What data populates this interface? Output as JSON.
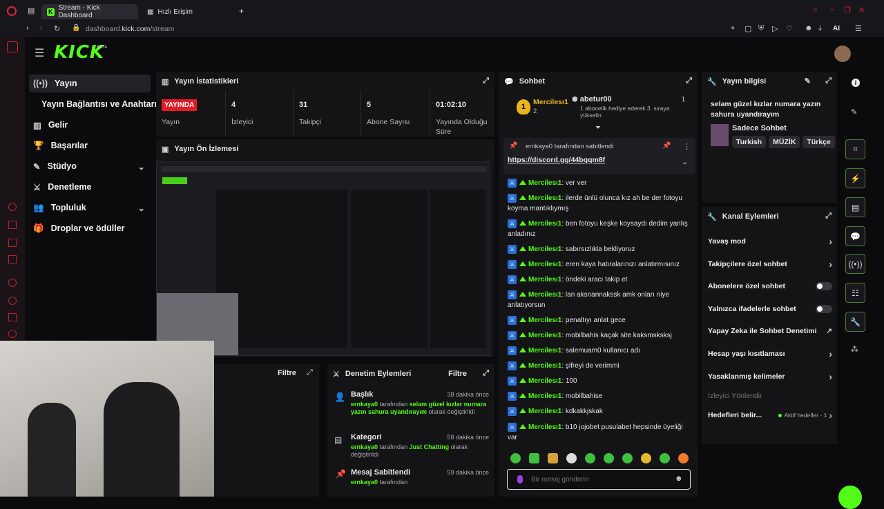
{
  "browser": {
    "tabs": [
      {
        "label": "Stream - Kick Dashboard"
      },
      {
        "label": "Hızlı Erişim"
      }
    ],
    "url_prefix": "dashboard.",
    "url_host": "kick.com",
    "url_path": "/stream",
    "ai_label": "AI"
  },
  "brand": {
    "logo": "KICK",
    "beta": "BETA"
  },
  "nav": {
    "items": [
      {
        "label": "Yayın"
      },
      {
        "label": "Yayın Bağlantısı ve Anahtarı"
      },
      {
        "label": "Gelir"
      },
      {
        "label": "Başarılar"
      },
      {
        "label": "Stüdyo"
      },
      {
        "label": "Denetleme"
      },
      {
        "label": "Topluluk"
      },
      {
        "label": "Droplar ve ödüller"
      }
    ]
  },
  "stats": {
    "title": "Yayın İstatistikleri",
    "live_badge": "YAYINDA",
    "items": [
      {
        "label": "Yayın",
        "value": ""
      },
      {
        "label": "İzleyici",
        "value": "4"
      },
      {
        "label": "Takipçi",
        "value": "31"
      },
      {
        "label": "Abone Sayısı",
        "value": "5"
      },
      {
        "label": "Yayında Olduğu Süre",
        "value": "01:02:10"
      }
    ]
  },
  "preview": {
    "title": "Yayın Ön İzlemesi"
  },
  "filter_panel": {
    "filter_label": "Filtre"
  },
  "mod_actions": {
    "title": "Denetim Eylemleri",
    "filter_label": "Filtre",
    "items": [
      {
        "title": "Başlık",
        "time": "38 dakika önce",
        "actor": "ernkaya0",
        "pre": " tarafından ",
        "highlight": "selam güzel kızlar numara yazın sahura uyandırayım",
        "post": " olarak değiştirildi"
      },
      {
        "title": "Kategori",
        "time": "58 dakika önce",
        "actor": "ernkaya0",
        "pre": " tarafından ",
        "highlight": "Just Chatting",
        "post": " olarak değiştirildi"
      },
      {
        "title": "Mesaj Sabitlendi",
        "time": "59 dakika önce",
        "actor": "ernkaya0",
        "pre": " tarafından",
        "highlight": "",
        "post": ""
      }
    ]
  },
  "chat": {
    "title": "Sohbet",
    "top_gifter": {
      "name": "Mercilesı1",
      "count": "2"
    },
    "gift_user": {
      "name": "abetur00",
      "count": "1",
      "text": "1 abonelik hediye ederek 3. sıraya yükselin"
    },
    "pinned": {
      "by": "ernkaya0 tarafından sabitlendi",
      "link": "https://discord.gg/44bqqm8f"
    },
    "messages": [
      {
        "user": "Mercilesı1",
        "text": ": ver ver"
      },
      {
        "user": "Mercilesı1",
        "text": ": ilerde ünlü olunca kız ah be der fotoyu koyma mantıklıymış"
      },
      {
        "user": "Mercilesı1",
        "text": ": ben fotoyu keşke koysaydı dedim yanlış anladınız"
      },
      {
        "user": "Mercilesı1",
        "text": ": sabırsızlıkla bekliyoruz"
      },
      {
        "user": "Mercilesı1",
        "text": ": eren kaya hatıralarınızı anlatırmısınız"
      },
      {
        "user": "Mercilesı1",
        "text": ": öndeki aracı takip et"
      },
      {
        "user": "Mercilesı1",
        "text": ": lan aksnannakssk amk onları niye anlatıyorsun"
      },
      {
        "user": "Mercilesı1",
        "text": ": penaltıyı anlat gece"
      },
      {
        "user": "Mercilesı1",
        "text": ": mobilbahis kaçak site kaksmsksksj"
      },
      {
        "user": "Mercilesı1",
        "text": ": salemuam0 kullanıcı adı"
      },
      {
        "user": "Mercilesı1",
        "text": ": şifreyi de verimmi"
      },
      {
        "user": "Mercilesı1",
        "text": ": 100"
      },
      {
        "user": "Mercilesı1",
        "text": ": mobilbahise"
      },
      {
        "user": "Mercilesı1",
        "text": ": kdkakkjskak"
      },
      {
        "user": "Mercilesı1",
        "text": ": b10 jojobet pusulabet hepsinde üyeliği var"
      }
    ],
    "input_placeholder": "Bir mesaj gönderin"
  },
  "stream_info": {
    "title": "Yayın bilgisi",
    "stream_title": "selam güzel kızlar numara yazın sahura uyandırayım",
    "category": "Sadece Sohbet",
    "tags": [
      "Turkish",
      "MÜZİK",
      "Türkçe"
    ]
  },
  "channel_actions": {
    "title": "Kanal Eylemleri",
    "rows": [
      {
        "label": "Yavaş mod",
        "control": "chevron"
      },
      {
        "label": "Takipçilere özel sohbet",
        "control": "chevron"
      },
      {
        "label": "Abonelere özel sohbet",
        "control": "toggle"
      },
      {
        "label": "Yalnızca ifadelerle sohbet",
        "control": "toggle"
      },
      {
        "label": "Yapay Zeka ile Sohbet Denetimi",
        "control": "external"
      },
      {
        "label": "Hesap yaşı kısıtlaması",
        "control": "chevron"
      },
      {
        "label": "Yasaklanmış kelimeler",
        "control": "chevron"
      }
    ],
    "redirect_label": "İzleyici Yönlendir",
    "targets_label": "Hedefleri belir...",
    "targets_status": "Aktif hedefler - 1"
  },
  "colors": {
    "brand": "#53fc18",
    "live": "#e31c25",
    "badge_blue": "#2a6fd6"
  }
}
